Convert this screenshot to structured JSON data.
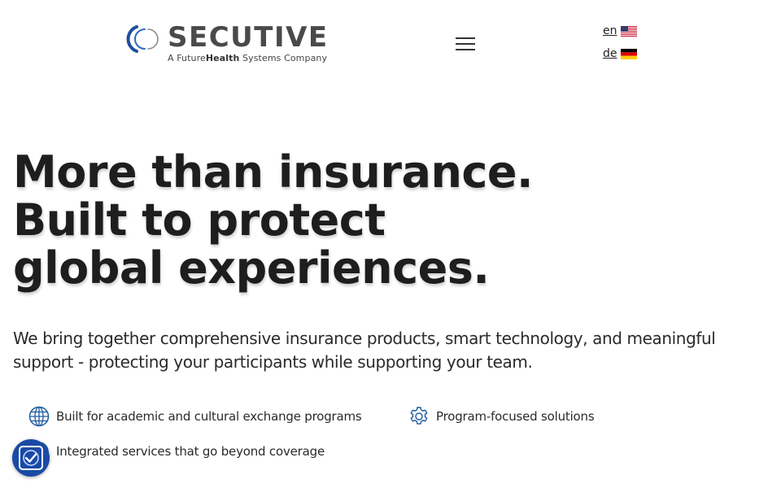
{
  "header": {
    "logo": {
      "wordmark": "SECUTIVE",
      "tagline_prefix": "A Future",
      "tagline_bold": "Health",
      "tagline_suffix": " Systems Company"
    },
    "menu_icon": "hamburger-menu-icon",
    "languages": [
      {
        "code": "en",
        "flag": "us-flag-icon"
      },
      {
        "code": "de",
        "flag": "german-flag-icon"
      }
    ]
  },
  "hero": {
    "title_lines": [
      "More than insurance.",
      "Built to protect",
      "global experiences."
    ],
    "subtitle": "We bring together comprehensive insurance products, smart technology, and meaningful support - protecting your participants while supporting your team."
  },
  "features": [
    {
      "label": "Built for academic and cultural exchange programs",
      "icon": "globe-icon"
    },
    {
      "label": "Program-focused solutions",
      "icon": "gear-icon"
    },
    {
      "label": "Integrated services that go beyond coverage",
      "icon": "services-icon"
    }
  ],
  "consent": {
    "icon": "privacy-check-icon"
  },
  "colors": {
    "text": "#1e1e1e",
    "logo_grey": "#4a4a4a",
    "logo_blue": "#1f4f9c",
    "icon_blue": "#1d5aa0",
    "consent_bg": "#1a4aa6"
  }
}
